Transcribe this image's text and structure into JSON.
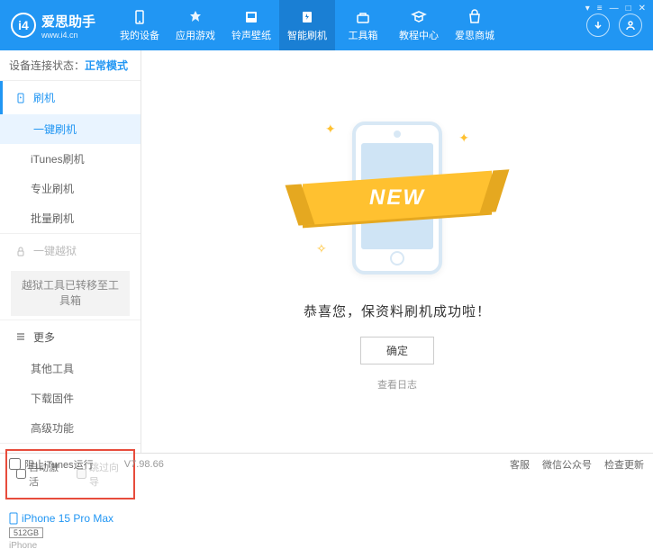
{
  "logo": {
    "text": "爱思助手",
    "sub": "www.i4.cn"
  },
  "nav": [
    {
      "label": "我的设备"
    },
    {
      "label": "应用游戏"
    },
    {
      "label": "铃声壁纸"
    },
    {
      "label": "智能刷机",
      "active": true
    },
    {
      "label": "工具箱"
    },
    {
      "label": "教程中心"
    },
    {
      "label": "爱思商城"
    }
  ],
  "status": {
    "label": "设备连接状态：",
    "value": "正常模式"
  },
  "sidebar": {
    "flash": {
      "header": "刷机",
      "items": [
        "一键刷机",
        "iTunes刷机",
        "专业刷机",
        "批量刷机"
      ]
    },
    "jailbreak": {
      "header": "一键越狱",
      "note": "越狱工具已转移至工具箱"
    },
    "more": {
      "header": "更多",
      "items": [
        "其他工具",
        "下载固件",
        "高级功能"
      ]
    }
  },
  "options": {
    "auto_activate": "自动激活",
    "skip_guide": "跳过向导"
  },
  "device": {
    "name": "iPhone 15 Pro Max",
    "storage": "512GB",
    "type": "iPhone"
  },
  "main": {
    "ribbon": "NEW",
    "success": "恭喜您，保资料刷机成功啦！",
    "ok": "确定",
    "log": "查看日志"
  },
  "footer": {
    "block_itunes": "阻止iTunes运行",
    "version": "V7.98.66",
    "links": [
      "客服",
      "微信公众号",
      "检查更新"
    ]
  }
}
